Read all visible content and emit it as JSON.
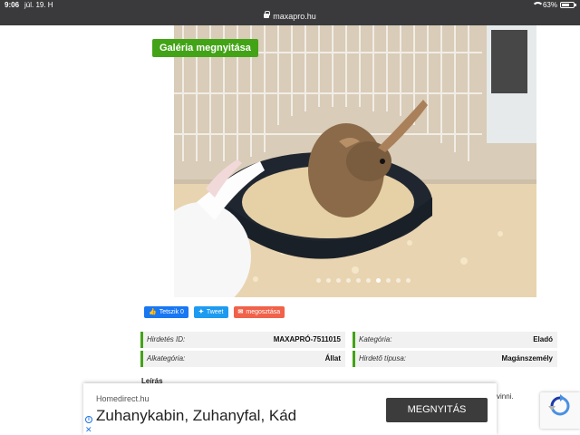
{
  "status_bar": {
    "time": "9:06",
    "date": "júl. 19. H",
    "url": "maxapro.hu",
    "battery": "63%"
  },
  "gallery": {
    "button_label": "Galéria megnyitása",
    "photo_count": 10,
    "active_index": 7
  },
  "share": {
    "facebook_label": "Tetszik 0",
    "twitter_label": "Tweet",
    "share_label": "megosztása"
  },
  "details": {
    "id_label": "Hirdetés ID:",
    "id_value": "MAXAPRÓ-7511015",
    "category_label": "Kategória:",
    "category_value": "Eladó",
    "subcategory_label": "Alkategória:",
    "subcategory_value": "Állat",
    "type_label": "Hirdető típusa:",
    "type_value": "Magánszemély"
  },
  "description": {
    "heading": "Leírás",
    "partial_text": "vinni."
  },
  "ad": {
    "domain": "Homedirect.hu",
    "headline": "Zuhanykabin, Zuhanyfal, Kád",
    "cta": "MEGNYITÁS"
  },
  "colors": {
    "accent": "#43a317",
    "statusbar": "#3a3a3c",
    "facebook": "#1877f2",
    "twitter": "#1d9bf0",
    "share": "#f0624a"
  }
}
